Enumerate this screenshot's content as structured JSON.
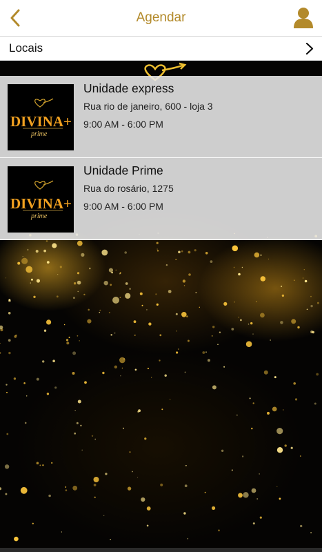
{
  "header": {
    "title": "Agendar",
    "back_icon": "chevron-left-icon",
    "profile_icon": "user-icon",
    "accent_color": "#b38a2b"
  },
  "section": {
    "label": "Locais",
    "chevron_icon": "chevron-right-icon"
  },
  "locations": [
    {
      "name": "Unidade express",
      "address": "Rua rio de janeiro, 600 - loja 3",
      "hours": "9:00 AM - 6:00 PM",
      "logo_text": "DIVINA+",
      "logo_sub": "prime"
    },
    {
      "name": "Unidade Prime",
      "address": "Rua do rosário, 1275",
      "hours": "9:00 AM - 6:00 PM",
      "logo_text": "DIVINA+",
      "logo_sub": "prime"
    }
  ]
}
